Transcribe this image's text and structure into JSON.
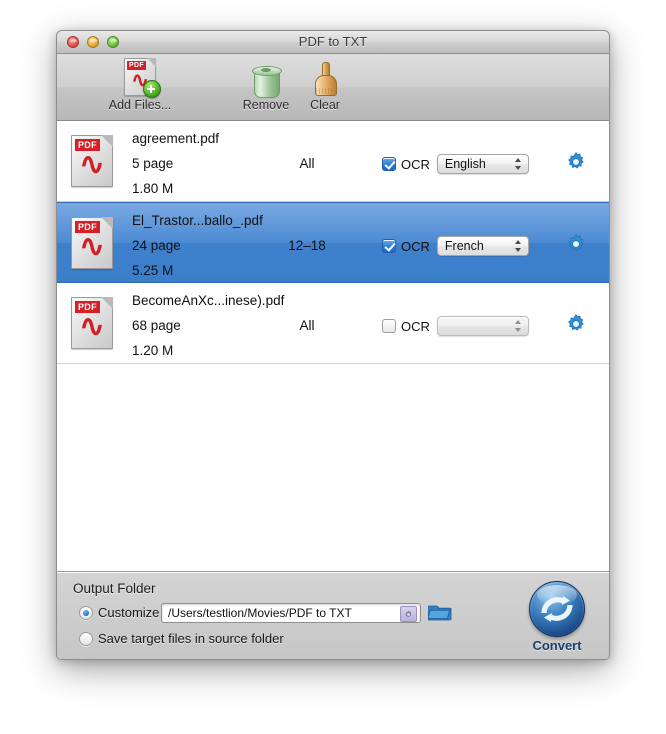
{
  "window": {
    "title": "PDF to TXT",
    "traffic_lights": {
      "close": "close-button",
      "minimize": "minimize-button",
      "zoom": "zoom-button"
    }
  },
  "toolbar": {
    "add_files_label": "Add Files...",
    "remove_label": "Remove",
    "clear_label": "Clear"
  },
  "file_list": {
    "rows": [
      {
        "name": "agreement.pdf",
        "pages": "5 page",
        "size": "1.80 M",
        "range": "All",
        "ocr_label": "OCR",
        "ocr_checked": true,
        "language": "English",
        "selected": false
      },
      {
        "name": "El_Trastor...ballo_.pdf",
        "pages": "24 page",
        "size": "5.25 M",
        "range": "12–18",
        "ocr_label": "OCR",
        "ocr_checked": true,
        "language": "French",
        "selected": true
      },
      {
        "name": "BecomeAnXc...inese).pdf",
        "pages": "68 page",
        "size": "1.20 M",
        "range": "All",
        "ocr_label": "OCR",
        "ocr_checked": false,
        "language": "",
        "selected": false
      }
    ]
  },
  "output": {
    "section_title": "Output Folder",
    "customize_label": "Customize",
    "customize_selected": true,
    "path_value": "/Users/testlion/Movies/PDF to TXT",
    "source_folder_label": "Save target files in source folder",
    "source_folder_selected": false,
    "convert_label": "Convert"
  },
  "colors": {
    "selection_blue": "#3f80cc",
    "accent_blue": "#2f7ed6",
    "pdf_red": "#d81f26",
    "convert_blue": "#1d4f8f"
  }
}
